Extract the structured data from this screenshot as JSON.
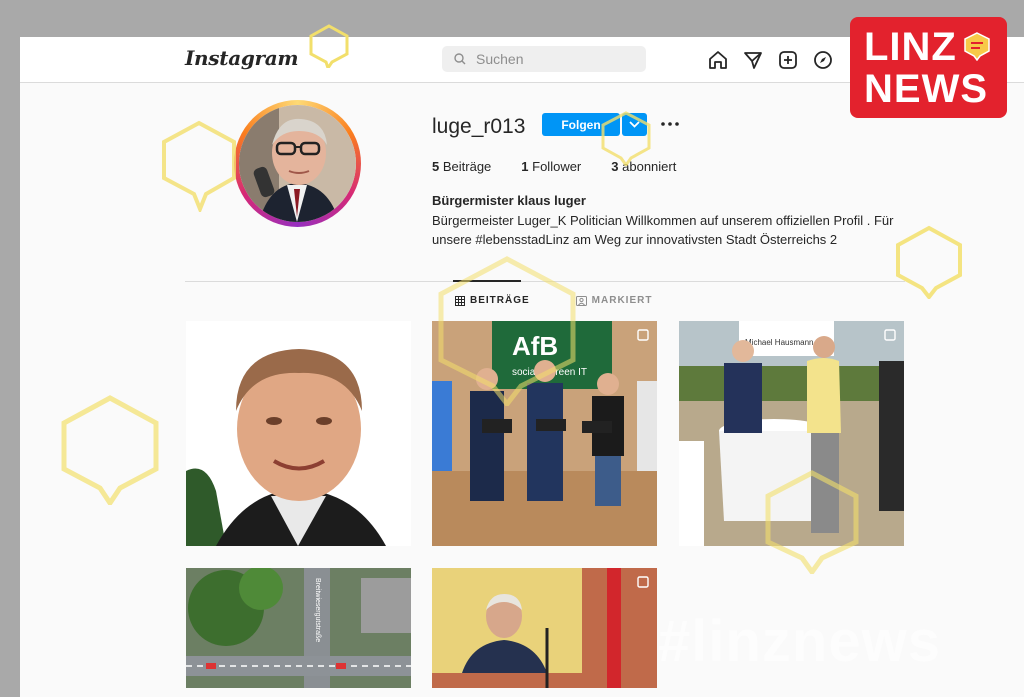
{
  "header": {
    "logo": "Instagram",
    "search_placeholder": "Suchen",
    "nav_icons": [
      "home-icon",
      "direct-icon",
      "new-post-icon",
      "explore-icon"
    ]
  },
  "profile": {
    "username": "luge_r013",
    "follow_label": "Folgen",
    "stats": [
      {
        "count": "5",
        "label": "Beiträge"
      },
      {
        "count": "1",
        "label": "Follower"
      },
      {
        "count": "3",
        "label": "abonniert"
      }
    ],
    "bio_name": "Bürgermister klaus luger",
    "bio_text": "Bürgermeister Luger_K Politician Willkommen auf unserem offiziellen Profil . Für unsere #lebensstadLinz am Weg zur innovativsten Stadt Österreichs 2"
  },
  "tabs": [
    {
      "label": "BEITRÄGE",
      "active": true
    },
    {
      "label": "MARKIERT",
      "active": false
    }
  ],
  "posts": [
    {
      "name": "post-portrait",
      "multi": false
    },
    {
      "name": "post-afb-event",
      "multi": true,
      "banner": "AfB",
      "banner_sub": "social & green IT"
    },
    {
      "name": "post-reception",
      "multi": true,
      "sign": "Michael Hausmann"
    },
    {
      "name": "post-map",
      "multi": false,
      "street": "Breitwiesergutstraße"
    },
    {
      "name": "post-speech",
      "multi": true
    }
  ],
  "watermark": {
    "badge_line1": "LINZ",
    "badge_line2": "NEWS",
    "hashtag": "#linznews"
  },
  "colors": {
    "accent": "#0095f6",
    "brand_red": "#e3222d",
    "overlay_yellow": "#f2df6b"
  }
}
